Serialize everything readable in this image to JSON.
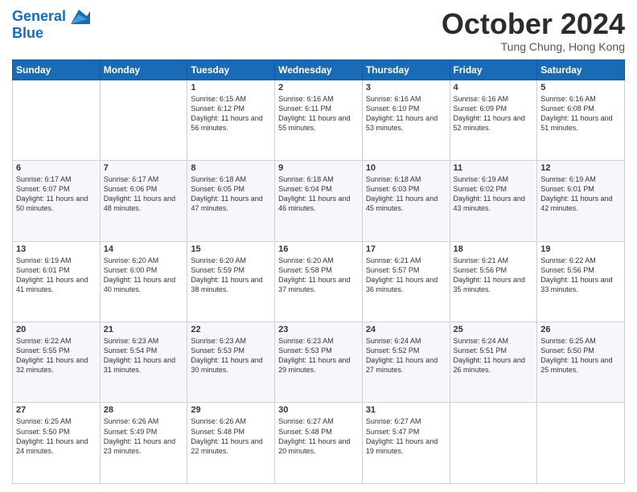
{
  "header": {
    "logo_line1": "General",
    "logo_line2": "Blue",
    "month_title": "October 2024",
    "subtitle": "Tung Chung, Hong Kong"
  },
  "days_of_week": [
    "Sunday",
    "Monday",
    "Tuesday",
    "Wednesday",
    "Thursday",
    "Friday",
    "Saturday"
  ],
  "weeks": [
    [
      {
        "day": "",
        "sunrise": "",
        "sunset": "",
        "daylight": ""
      },
      {
        "day": "",
        "sunrise": "",
        "sunset": "",
        "daylight": ""
      },
      {
        "day": "1",
        "sunrise": "Sunrise: 6:15 AM",
        "sunset": "Sunset: 6:12 PM",
        "daylight": "Daylight: 11 hours and 56 minutes."
      },
      {
        "day": "2",
        "sunrise": "Sunrise: 6:16 AM",
        "sunset": "Sunset: 6:11 PM",
        "daylight": "Daylight: 11 hours and 55 minutes."
      },
      {
        "day": "3",
        "sunrise": "Sunrise: 6:16 AM",
        "sunset": "Sunset: 6:10 PM",
        "daylight": "Daylight: 11 hours and 53 minutes."
      },
      {
        "day": "4",
        "sunrise": "Sunrise: 6:16 AM",
        "sunset": "Sunset: 6:09 PM",
        "daylight": "Daylight: 11 hours and 52 minutes."
      },
      {
        "day": "5",
        "sunrise": "Sunrise: 6:16 AM",
        "sunset": "Sunset: 6:08 PM",
        "daylight": "Daylight: 11 hours and 51 minutes."
      }
    ],
    [
      {
        "day": "6",
        "sunrise": "Sunrise: 6:17 AM",
        "sunset": "Sunset: 6:07 PM",
        "daylight": "Daylight: 11 hours and 50 minutes."
      },
      {
        "day": "7",
        "sunrise": "Sunrise: 6:17 AM",
        "sunset": "Sunset: 6:06 PM",
        "daylight": "Daylight: 11 hours and 48 minutes."
      },
      {
        "day": "8",
        "sunrise": "Sunrise: 6:18 AM",
        "sunset": "Sunset: 6:05 PM",
        "daylight": "Daylight: 11 hours and 47 minutes."
      },
      {
        "day": "9",
        "sunrise": "Sunrise: 6:18 AM",
        "sunset": "Sunset: 6:04 PM",
        "daylight": "Daylight: 11 hours and 46 minutes."
      },
      {
        "day": "10",
        "sunrise": "Sunrise: 6:18 AM",
        "sunset": "Sunset: 6:03 PM",
        "daylight": "Daylight: 11 hours and 45 minutes."
      },
      {
        "day": "11",
        "sunrise": "Sunrise: 6:19 AM",
        "sunset": "Sunset: 6:02 PM",
        "daylight": "Daylight: 11 hours and 43 minutes."
      },
      {
        "day": "12",
        "sunrise": "Sunrise: 6:19 AM",
        "sunset": "Sunset: 6:01 PM",
        "daylight": "Daylight: 11 hours and 42 minutes."
      }
    ],
    [
      {
        "day": "13",
        "sunrise": "Sunrise: 6:19 AM",
        "sunset": "Sunset: 6:01 PM",
        "daylight": "Daylight: 11 hours and 41 minutes."
      },
      {
        "day": "14",
        "sunrise": "Sunrise: 6:20 AM",
        "sunset": "Sunset: 6:00 PM",
        "daylight": "Daylight: 11 hours and 40 minutes."
      },
      {
        "day": "15",
        "sunrise": "Sunrise: 6:20 AM",
        "sunset": "Sunset: 5:59 PM",
        "daylight": "Daylight: 11 hours and 38 minutes."
      },
      {
        "day": "16",
        "sunrise": "Sunrise: 6:20 AM",
        "sunset": "Sunset: 5:58 PM",
        "daylight": "Daylight: 11 hours and 37 minutes."
      },
      {
        "day": "17",
        "sunrise": "Sunrise: 6:21 AM",
        "sunset": "Sunset: 5:57 PM",
        "daylight": "Daylight: 11 hours and 36 minutes."
      },
      {
        "day": "18",
        "sunrise": "Sunrise: 6:21 AM",
        "sunset": "Sunset: 5:56 PM",
        "daylight": "Daylight: 11 hours and 35 minutes."
      },
      {
        "day": "19",
        "sunrise": "Sunrise: 6:22 AM",
        "sunset": "Sunset: 5:56 PM",
        "daylight": "Daylight: 11 hours and 33 minutes."
      }
    ],
    [
      {
        "day": "20",
        "sunrise": "Sunrise: 6:22 AM",
        "sunset": "Sunset: 5:55 PM",
        "daylight": "Daylight: 11 hours and 32 minutes."
      },
      {
        "day": "21",
        "sunrise": "Sunrise: 6:23 AM",
        "sunset": "Sunset: 5:54 PM",
        "daylight": "Daylight: 11 hours and 31 minutes."
      },
      {
        "day": "22",
        "sunrise": "Sunrise: 6:23 AM",
        "sunset": "Sunset: 5:53 PM",
        "daylight": "Daylight: 11 hours and 30 minutes."
      },
      {
        "day": "23",
        "sunrise": "Sunrise: 6:23 AM",
        "sunset": "Sunset: 5:53 PM",
        "daylight": "Daylight: 11 hours and 29 minutes."
      },
      {
        "day": "24",
        "sunrise": "Sunrise: 6:24 AM",
        "sunset": "Sunset: 5:52 PM",
        "daylight": "Daylight: 11 hours and 27 minutes."
      },
      {
        "day": "25",
        "sunrise": "Sunrise: 6:24 AM",
        "sunset": "Sunset: 5:51 PM",
        "daylight": "Daylight: 11 hours and 26 minutes."
      },
      {
        "day": "26",
        "sunrise": "Sunrise: 6:25 AM",
        "sunset": "Sunset: 5:50 PM",
        "daylight": "Daylight: 11 hours and 25 minutes."
      }
    ],
    [
      {
        "day": "27",
        "sunrise": "Sunrise: 6:25 AM",
        "sunset": "Sunset: 5:50 PM",
        "daylight": "Daylight: 11 hours and 24 minutes."
      },
      {
        "day": "28",
        "sunrise": "Sunrise: 6:26 AM",
        "sunset": "Sunset: 5:49 PM",
        "daylight": "Daylight: 11 hours and 23 minutes."
      },
      {
        "day": "29",
        "sunrise": "Sunrise: 6:26 AM",
        "sunset": "Sunset: 5:48 PM",
        "daylight": "Daylight: 11 hours and 22 minutes."
      },
      {
        "day": "30",
        "sunrise": "Sunrise: 6:27 AM",
        "sunset": "Sunset: 5:48 PM",
        "daylight": "Daylight: 11 hours and 20 minutes."
      },
      {
        "day": "31",
        "sunrise": "Sunrise: 6:27 AM",
        "sunset": "Sunset: 5:47 PM",
        "daylight": "Daylight: 11 hours and 19 minutes."
      },
      {
        "day": "",
        "sunrise": "",
        "sunset": "",
        "daylight": ""
      },
      {
        "day": "",
        "sunrise": "",
        "sunset": "",
        "daylight": ""
      }
    ]
  ]
}
